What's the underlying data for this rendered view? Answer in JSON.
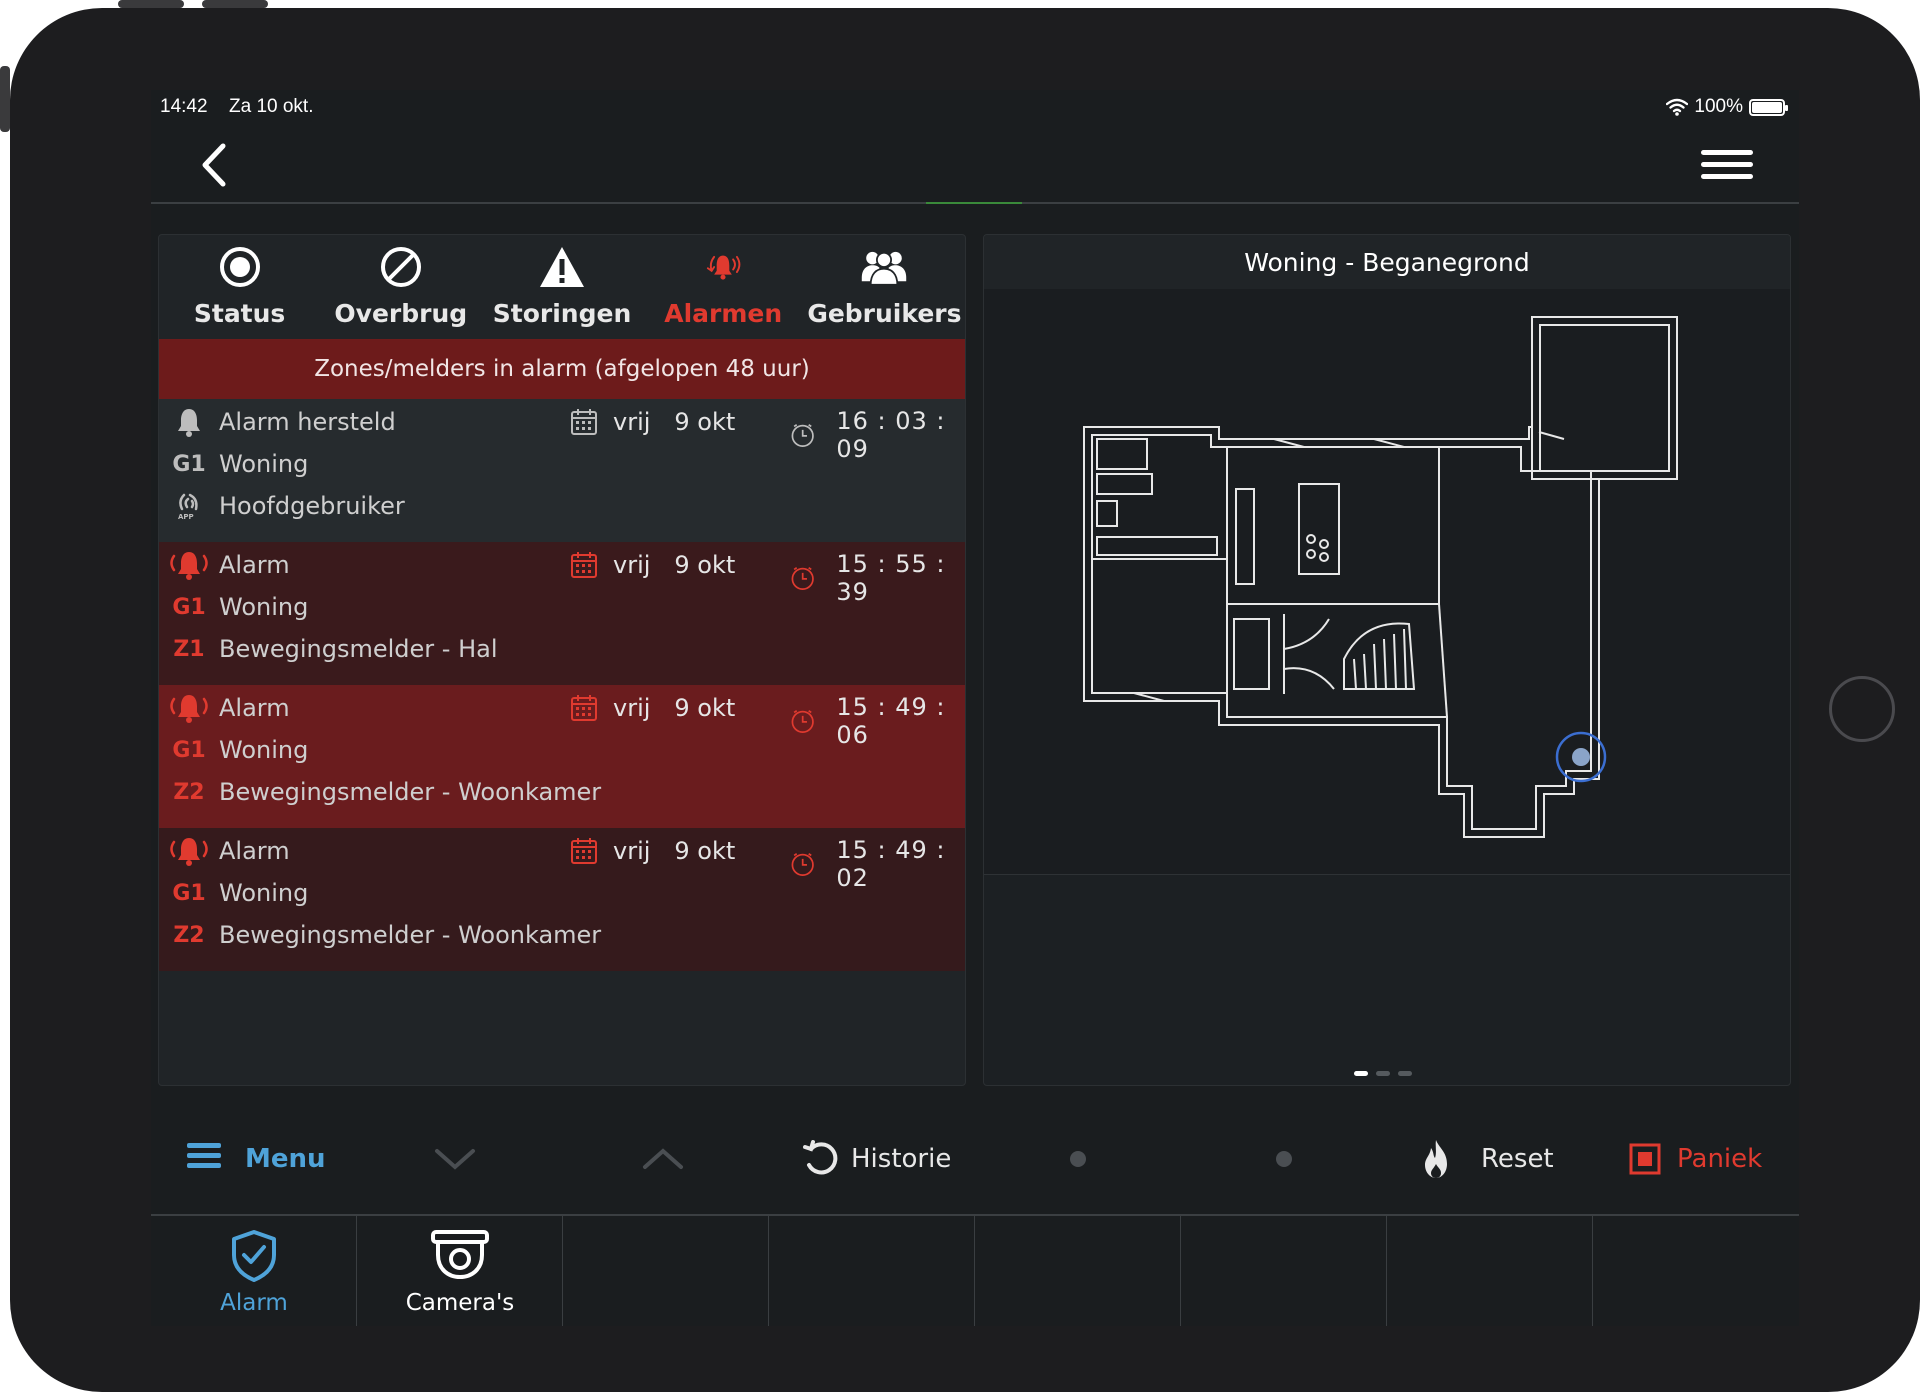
{
  "status_bar": {
    "time": "14:42",
    "date": "Za 10 okt.",
    "battery": "100%"
  },
  "tabs": [
    {
      "label": "Status",
      "icon": "status-icon"
    },
    {
      "label": "Overbrug",
      "icon": "bypass-icon"
    },
    {
      "label": "Storingen",
      "icon": "warning-icon"
    },
    {
      "label": "Alarmen",
      "icon": "alarm-bell-icon",
      "active": true
    },
    {
      "label": "Gebruikers",
      "icon": "users-icon"
    }
  ],
  "alarm_list": {
    "header": "Zones/melders in alarm (afgelopen 48 uur)",
    "events": [
      {
        "type": "Alarm hersteld",
        "group_code": "G1",
        "group": "Woning",
        "source_code": "",
        "source": "Hoofdgebruiker",
        "day": "vrij",
        "date": "9 okt",
        "time": "16 : 03 : 09"
      },
      {
        "type": "Alarm",
        "group_code": "G1",
        "group": "Woning",
        "source_code": "Z1",
        "source": "Bewegingsmelder - Hal",
        "day": "vrij",
        "date": "9 okt",
        "time": "15 : 55 : 39"
      },
      {
        "type": "Alarm",
        "group_code": "G1",
        "group": "Woning",
        "source_code": "Z2",
        "source": "Bewegingsmelder - Woonkamer",
        "day": "vrij",
        "date": "9 okt",
        "time": "15 : 49 : 06"
      },
      {
        "type": "Alarm",
        "group_code": "G1",
        "group": "Woning",
        "source_code": "Z2",
        "source": "Bewegingsmelder - Woonkamer",
        "day": "vrij",
        "date": "9 okt",
        "time": "15 : 49 : 02"
      }
    ]
  },
  "floorplan": {
    "title": "Woning - Beganegrond",
    "page_count": 3,
    "current_page": 1
  },
  "toolbar": {
    "menu": "Menu",
    "history": "Historie",
    "reset": "Reset",
    "panic": "Paniek"
  },
  "bottom_tabs": [
    {
      "label": "Alarm",
      "icon": "shield-check-icon",
      "active": true
    },
    {
      "label": "Camera's",
      "icon": "camera-icon"
    }
  ],
  "colors": {
    "accent_blue": "#4fa3d9",
    "alarm_red": "#e03a2f",
    "header_red": "#6d1b1b"
  }
}
